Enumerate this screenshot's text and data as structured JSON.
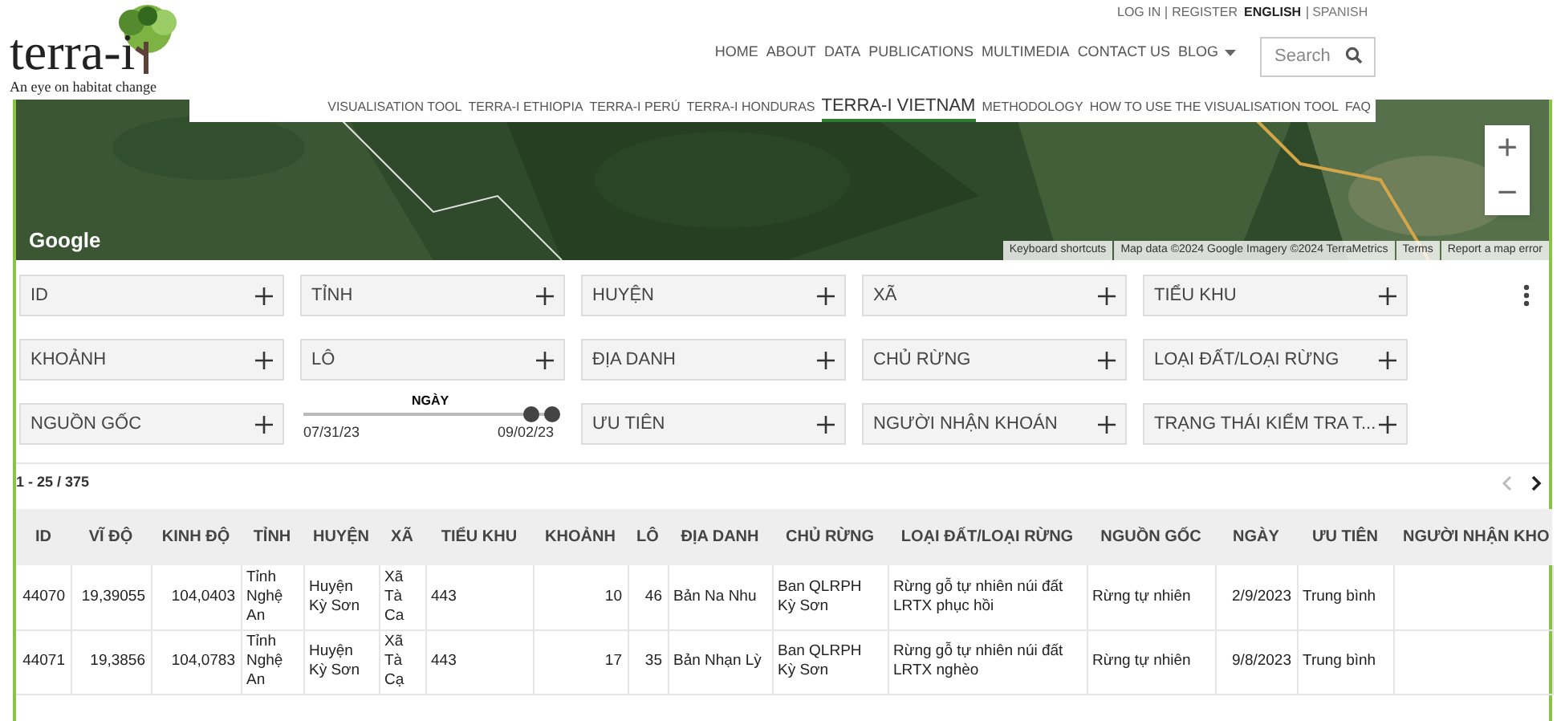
{
  "logo": {
    "name": "terra-i",
    "tagline": "An eye on habitat change"
  },
  "top_links": [
    {
      "label": "LOG IN"
    },
    {
      "label": "REGISTER"
    }
  ],
  "languages": [
    {
      "label": "ENGLISH",
      "selected": true
    },
    {
      "label": "SPANISH",
      "selected": false
    }
  ],
  "main_nav": [
    {
      "label": "HOME"
    },
    {
      "label": "ABOUT"
    },
    {
      "label": "DATA"
    },
    {
      "label": "PUBLICATIONS"
    },
    {
      "label": "MULTIMEDIA"
    },
    {
      "label": "CONTACT US"
    },
    {
      "label": "BLOG",
      "dropdown": true
    }
  ],
  "search": {
    "placeholder": "Search"
  },
  "sub_nav": [
    {
      "label": "VISUALISATION TOOL",
      "selected": false
    },
    {
      "label": "TERRA-I ETHIOPIA",
      "selected": false
    },
    {
      "label": "TERRA-I PERÚ",
      "selected": false
    },
    {
      "label": "TERRA-I HONDURAS",
      "selected": false
    },
    {
      "label": "TERRA-I VIETNAM",
      "selected": true
    },
    {
      "label": "METHODOLOGY",
      "selected": false
    },
    {
      "label": "HOW TO USE THE VISUALISATION TOOL",
      "selected": false
    },
    {
      "label": "FAQ",
      "selected": false
    }
  ],
  "map": {
    "kind": "picture",
    "brand": "Google",
    "zoom_in": "+",
    "zoom_out": "−",
    "attribution": [
      "Keyboard shortcuts",
      "Map data ©2024 Google Imagery ©2024 TerraMetrics",
      "Terms",
      "Report a map error"
    ]
  },
  "filters": [
    {
      "kind": "filter",
      "label": "ID"
    },
    {
      "kind": "filter",
      "label": "TỈNH"
    },
    {
      "kind": "filter",
      "label": "HUYỆN"
    },
    {
      "kind": "filter",
      "label": "XÃ"
    },
    {
      "kind": "filter",
      "label": "TIỂU KHU"
    },
    {
      "kind": "filter",
      "label": "KHOẢNH"
    },
    {
      "kind": "filter",
      "label": "LÔ"
    },
    {
      "kind": "filter",
      "label": "ĐỊA DANH"
    },
    {
      "kind": "filter",
      "label": "CHỦ RỪNG"
    },
    {
      "kind": "filter",
      "label": "LOẠI ĐẤT/LOẠI RỪNG"
    },
    {
      "kind": "filter",
      "label": "NGUỒN GỐC"
    },
    {
      "kind": "range",
      "label": "NGÀY",
      "min": "07/31/23",
      "max": "09/02/23",
      "thumbs": [
        {
          "level": 0.89
        },
        {
          "level": 0.97
        }
      ]
    },
    {
      "kind": "filter",
      "label": "ƯU TIÊN"
    },
    {
      "kind": "filter",
      "label": "NGƯỜI NHẬN KHOÁN"
    },
    {
      "kind": "filter",
      "label": "TRẠNG THÁI KIỂM TRA T..."
    }
  ],
  "pagination": {
    "range": "1 - 25 / 375",
    "prev_disabled": true
  },
  "table": {
    "columns": [
      "ID",
      "VĨ ĐỘ",
      "KINH ĐỘ",
      "TỈNH",
      "HUYỆN",
      "XÃ",
      "TIỂU KHU",
      "KHOẢNH",
      "LÔ",
      "ĐỊA DANH",
      "CHỦ RỪNG",
      "LOẠI ĐẤT/LOẠI RỪNG",
      "NGUỒN GỐC",
      "NGÀY",
      "ƯU TIÊN",
      "NGƯỜI NHẬN KHO"
    ],
    "rows": [
      [
        "44070",
        "19,39055",
        "104,0403",
        "Tỉnh Nghệ An",
        "Huyện Kỳ Sơn",
        "Xã Tà Ca",
        "443",
        "10",
        "46",
        "Bản Na Nhu",
        "Ban QLRPH Kỳ Sơn",
        "Rừng gỗ tự nhiên núi đất LRTX phục hồi",
        "Rừng tự nhiên",
        "2/9/2023",
        "Trung bình",
        ""
      ],
      [
        "44071",
        "19,3856",
        "104,0783",
        "Tỉnh Nghệ An",
        "Huyện Kỳ Sơn",
        "Xã Tà Cạ",
        "443",
        "17",
        "35",
        "Bản Nhạn Lỳ",
        "Ban QLRPH Kỳ Sơn",
        "Rừng gỗ tự nhiên núi đất LRTX nghèo",
        "Rừng tự nhiên",
        "9/8/2023",
        "Trung bình",
        ""
      ]
    ]
  }
}
